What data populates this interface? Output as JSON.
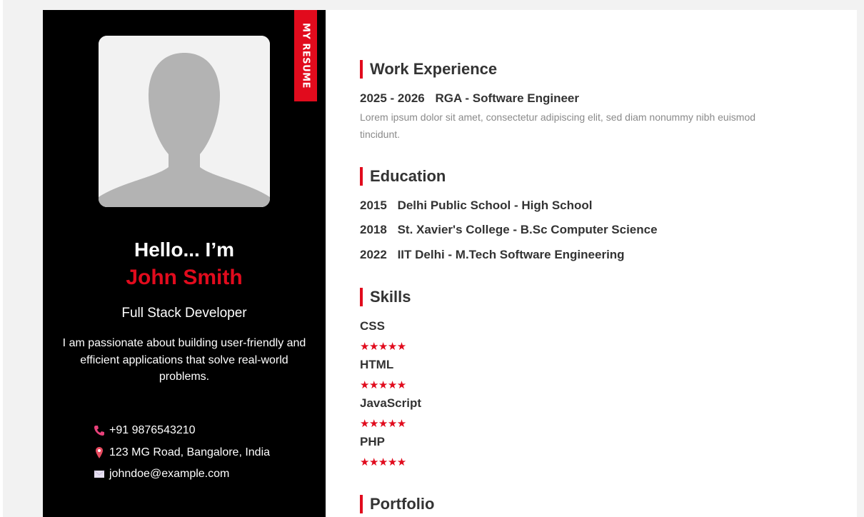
{
  "sidebar": {
    "ribbon_text": "MY RESUME",
    "hello": "Hello... I’m",
    "name": "John Smith",
    "role": "Full Stack Developer",
    "bio": "I am passionate about building user-friendly and efficient applications that solve real-world problems.",
    "contacts": {
      "phone": "+91 9876543210",
      "address": "123 MG Road, Bangalore, India",
      "email": "johndoe@example.com"
    }
  },
  "work": {
    "title": "Work Experience",
    "items": [
      {
        "years": "2025 - 2026",
        "role": "RGA - Software Engineer",
        "desc": "Lorem ipsum dolor sit amet, consectetur adipiscing elit, sed diam nonummy nibh euismod tincidunt."
      }
    ]
  },
  "education": {
    "title": "Education",
    "items": [
      {
        "year": "2015",
        "label": "Delhi Public School - High School"
      },
      {
        "year": "2018",
        "label": "St. Xavier's College - B.Sc Computer Science"
      },
      {
        "year": "2022",
        "label": "IIT Delhi - M.Tech Software Engineering"
      }
    ]
  },
  "skills": {
    "title": "Skills",
    "items": [
      {
        "name": "CSS",
        "stars": "★★★★★"
      },
      {
        "name": "HTML",
        "stars": "★★★★★"
      },
      {
        "name": "JavaScript",
        "stars": "★★★★★"
      },
      {
        "name": "PHP",
        "stars": "★★★★★"
      }
    ]
  },
  "portfolio": {
    "title": "Portfolio"
  },
  "icons": {
    "phone": "phone-icon",
    "location": "location-pin-icon",
    "email": "envelope-icon"
  },
  "colors": {
    "accent": "#e10b1d",
    "sidebar_bg": "#000000",
    "text_dark": "#333333",
    "text_muted": "#8a8a8a"
  }
}
